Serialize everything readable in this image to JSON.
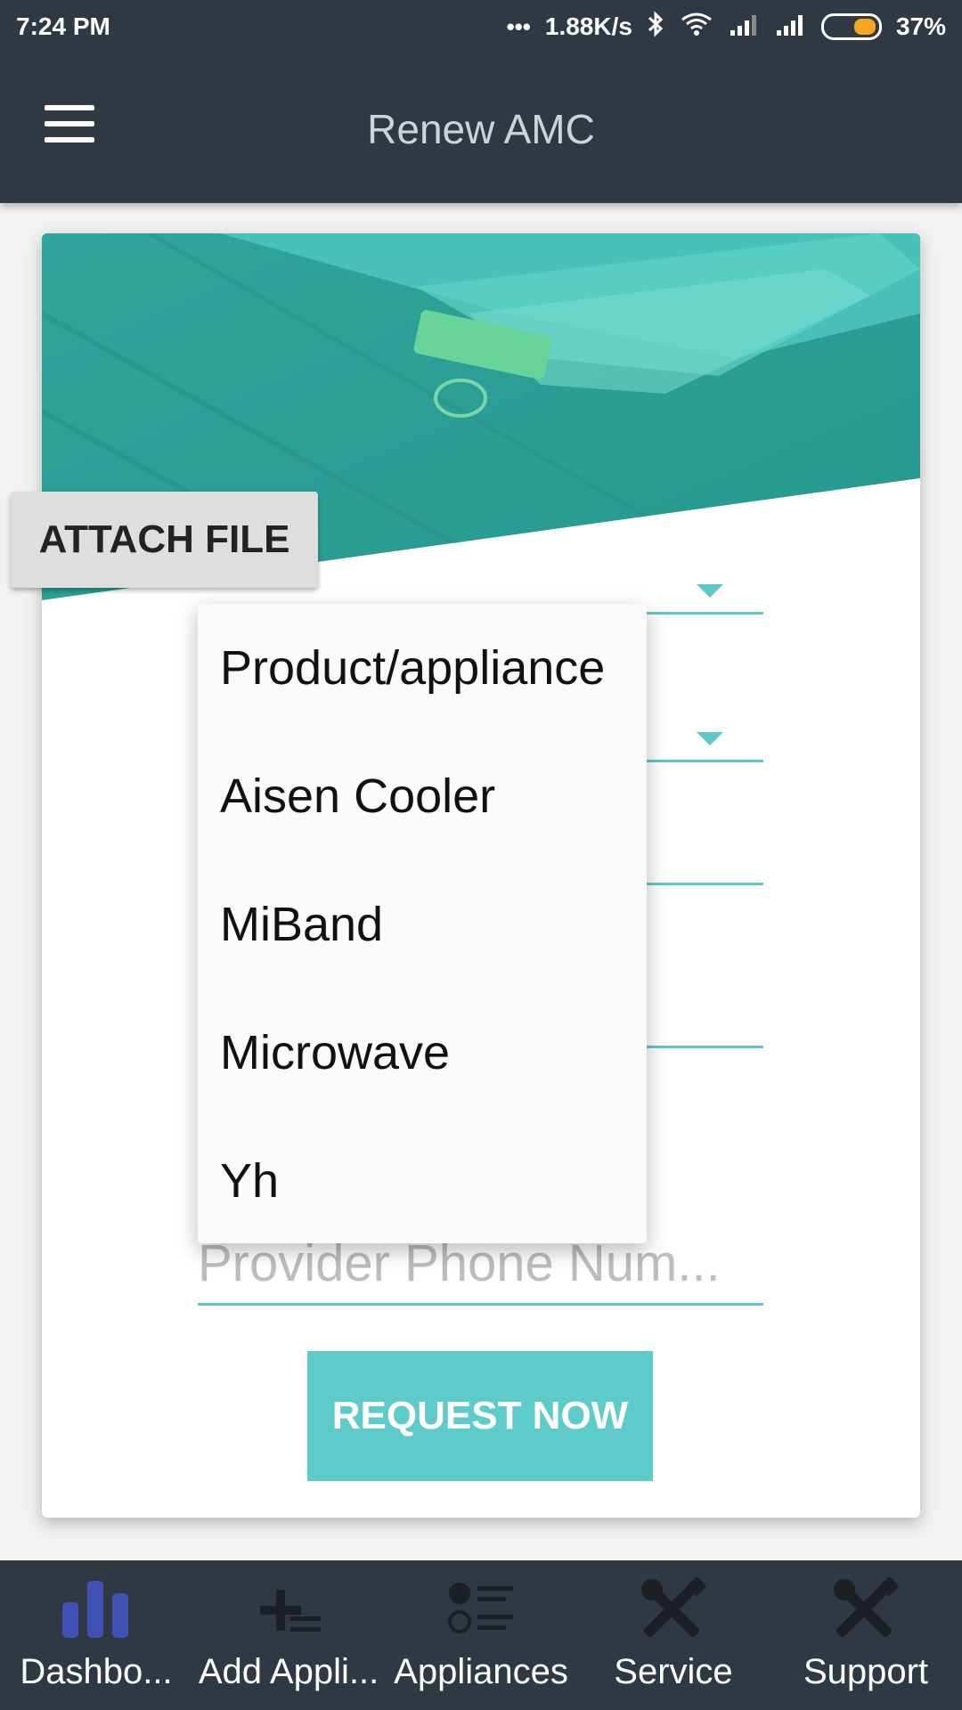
{
  "status_bar": {
    "time": "7:24 PM",
    "network_speed": "1.88K/s",
    "battery_percent": "37%",
    "battery_level": 0.37,
    "icons": [
      "dots-icon",
      "bluetooth-icon",
      "wifi-icon",
      "signal-icon",
      "signal-icon",
      "battery-icon"
    ]
  },
  "app_bar": {
    "title": "Renew AMC",
    "menu_icon": "hamburger-menu-icon"
  },
  "form": {
    "attach_file_label": "ATTACH FILE",
    "provider_phone_placeholder": "Provider Phone Num...",
    "request_button_label": "REQUEST NOW"
  },
  "dropdown": {
    "items": [
      "Product/appliance",
      "Aisen Cooler",
      "MiBand",
      "Microwave",
      "Yh"
    ]
  },
  "bottom_nav": {
    "items": [
      {
        "label": "Dashbo...",
        "icon": "bar-chart-icon",
        "active": true
      },
      {
        "label": "Add Appli...",
        "icon": "add-list-icon",
        "active": false
      },
      {
        "label": "Appliances",
        "icon": "list-icon",
        "active": false
      },
      {
        "label": "Service",
        "icon": "tools-icon",
        "active": false
      },
      {
        "label": "Support",
        "icon": "tools-icon",
        "active": false
      }
    ]
  },
  "colors": {
    "bar_background": "#303843",
    "accent_teal": "#5cc9c6",
    "active_icon": "#3f51b5",
    "battery_fill": "#f5a623"
  }
}
